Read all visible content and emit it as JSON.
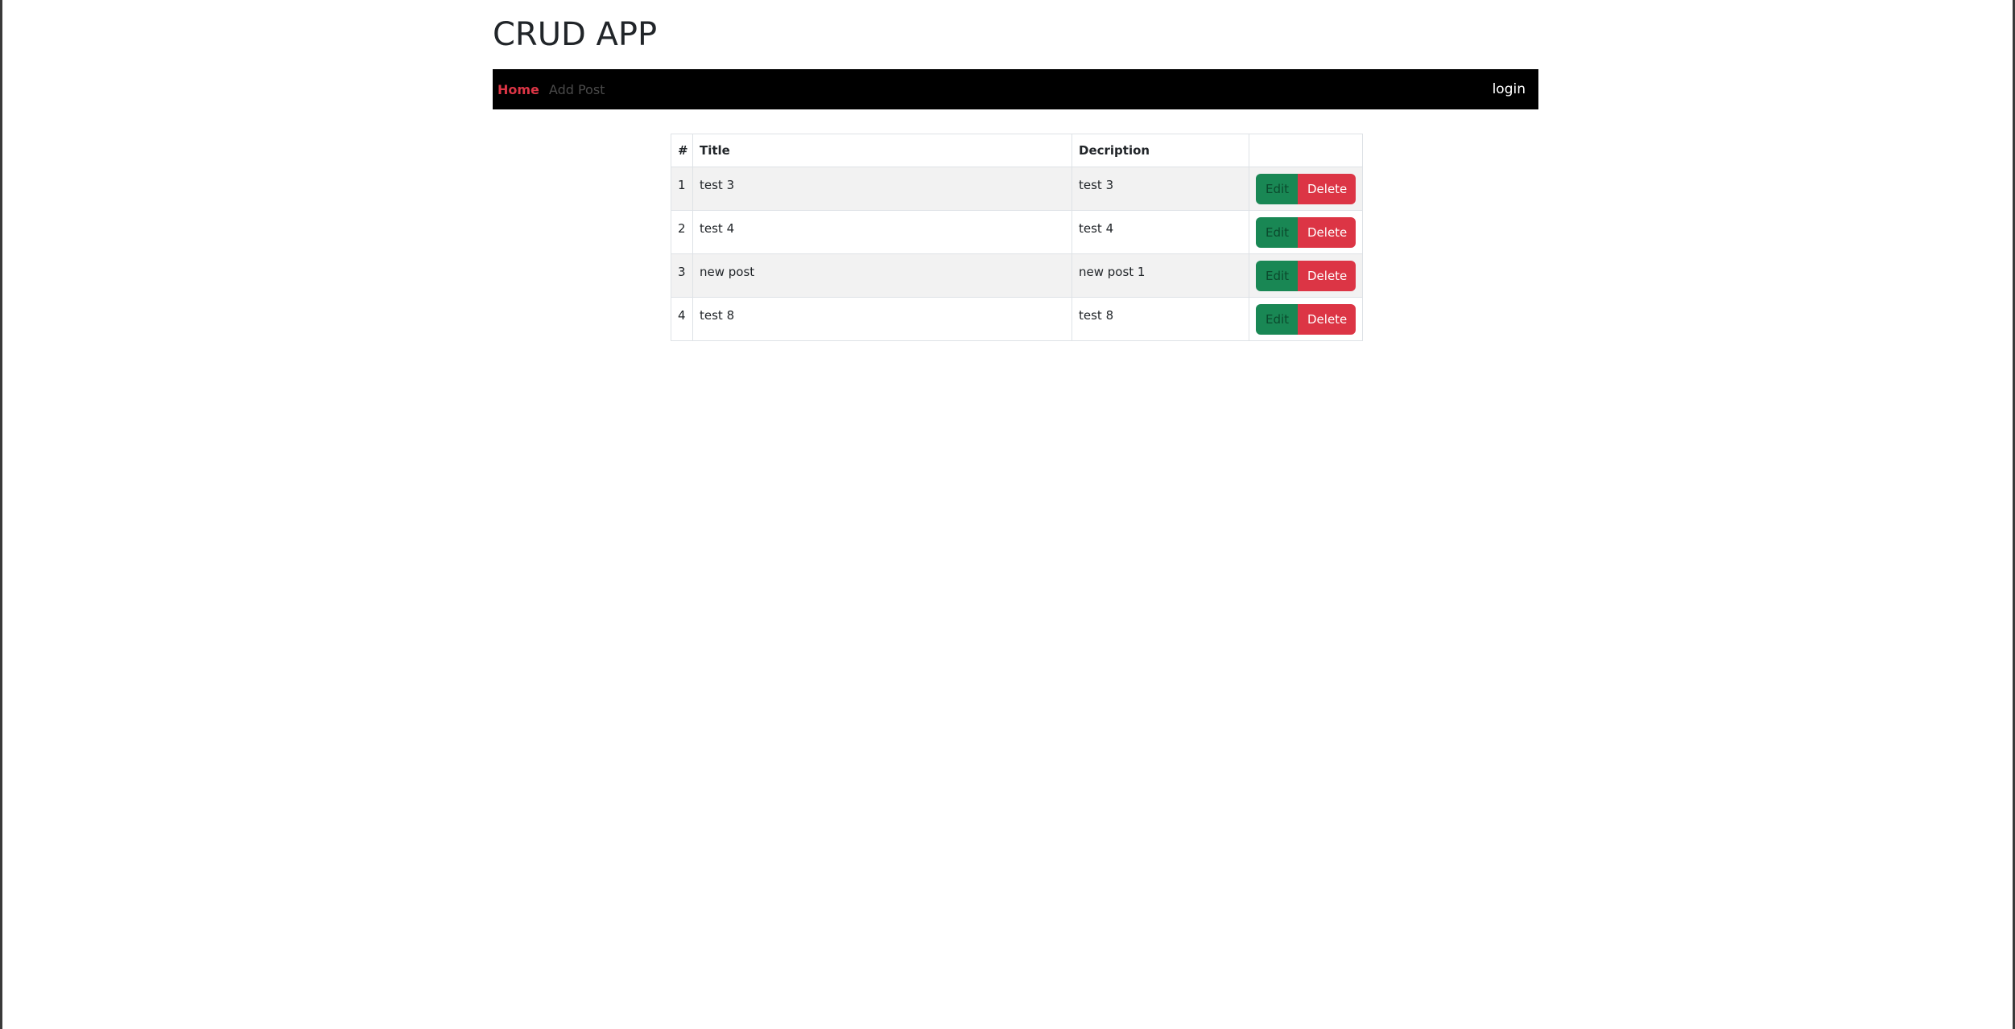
{
  "app": {
    "title": "CRUD APP"
  },
  "nav": {
    "home": "Home",
    "add_post": "Add Post",
    "login": "login"
  },
  "table": {
    "headers": {
      "num": "#",
      "title": "Title",
      "description": "Decription",
      "actions": ""
    },
    "rows": [
      {
        "num": "1",
        "title": "test 3",
        "description": "test 3",
        "edit": "Edit",
        "delete": "Delete"
      },
      {
        "num": "2",
        "title": "test 4",
        "description": "test 4",
        "edit": "Edit",
        "delete": "Delete"
      },
      {
        "num": "3",
        "title": "new post",
        "description": "new post 1",
        "edit": "Edit",
        "delete": "Delete"
      },
      {
        "num": "4",
        "title": "test 8",
        "description": "test 8",
        "edit": "Edit",
        "delete": "Delete"
      }
    ]
  },
  "colors": {
    "navbar_bg": "#000000",
    "nav_active": "#dc3545",
    "edit_button": "#198754",
    "delete_button": "#dc3545"
  }
}
